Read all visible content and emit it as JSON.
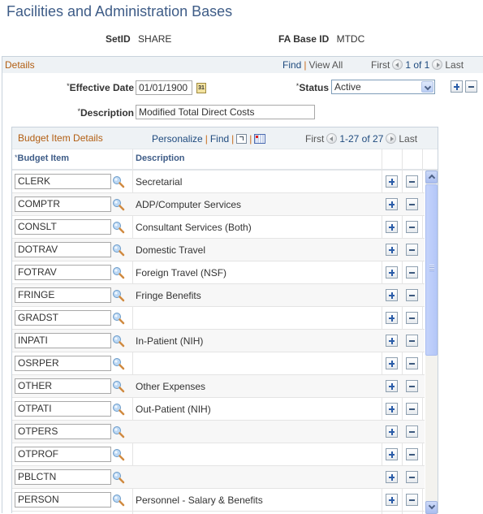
{
  "page": {
    "title": "Facilities and Administration Bases"
  },
  "keys": {
    "setid_label": "SetID",
    "setid_value": "SHARE",
    "fabase_label": "FA Base ID",
    "fabase_value": "MTDC"
  },
  "details": {
    "title": "Details",
    "find": "Find",
    "view_all": "View All",
    "first": "First",
    "counter": "1 of 1",
    "last": "Last",
    "effective_date_label": "Effective Date",
    "effective_date_value": "01/01/1900",
    "calendar_glyph": "31",
    "status_label": "Status",
    "status_value": "Active",
    "description_label": "Description",
    "description_value": "Modified Total Direct Costs",
    "required_mark": "*"
  },
  "grid": {
    "title": "Budget Item Details",
    "personalize": "Personalize",
    "find": "Find",
    "first": "First",
    "counter": "1-27 of 27",
    "last": "Last",
    "columns": {
      "budget_item": "Budget Item",
      "description": "Description"
    },
    "rows": [
      {
        "item": "CLERK",
        "desc": "Secretarial"
      },
      {
        "item": "COMPTR",
        "desc": "ADP/Computer Services"
      },
      {
        "item": "CONSLT",
        "desc": "Consultant Services (Both)"
      },
      {
        "item": "DOTRAV",
        "desc": "Domestic Travel"
      },
      {
        "item": "FOTRAV",
        "desc": "Foreign Travel (NSF)"
      },
      {
        "item": "FRINGE",
        "desc": "Fringe Benefits"
      },
      {
        "item": "GRADST",
        "desc": ""
      },
      {
        "item": "INPATI",
        "desc": "In-Patient (NIH)"
      },
      {
        "item": "OSRPER",
        "desc": ""
      },
      {
        "item": "OTHER",
        "desc": "Other Expenses"
      },
      {
        "item": "OTPATI",
        "desc": "Out-Patient (NIH)"
      },
      {
        "item": "OTPERS",
        "desc": ""
      },
      {
        "item": "OTPROF",
        "desc": ""
      },
      {
        "item": "PBLCTN",
        "desc": ""
      },
      {
        "item": "PERSON",
        "desc": "Personnel - Salary & Benefits"
      }
    ]
  }
}
